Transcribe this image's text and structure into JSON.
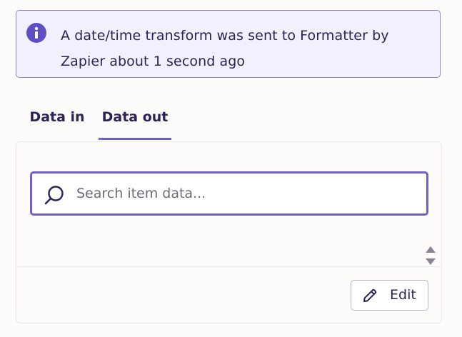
{
  "banner": {
    "icon": "info-icon",
    "message": "A date/time transform was sent to Formatter by Zapier about 1 second ago",
    "accent_color": "#5f4fc4",
    "background_color": "#f2f0fc"
  },
  "tabs": [
    {
      "label": "Data in",
      "active": false
    },
    {
      "label": "Data out",
      "active": true
    }
  ],
  "search": {
    "placeholder": "Search item data...",
    "value": "",
    "icon": "search-icon"
  },
  "scroll": {
    "icon": "scroll-arrows-icon"
  },
  "edit_button": {
    "label": "Edit",
    "icon": "pencil-icon"
  }
}
